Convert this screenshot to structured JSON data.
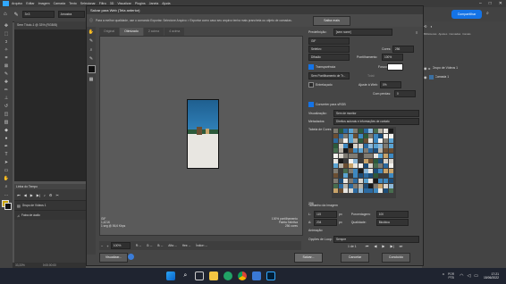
{
  "ps": {
    "menu": [
      "Arquivo",
      "Editar",
      "Imagem",
      "Camada",
      "Texto",
      "Selecionar",
      "Filtro",
      "3D",
      "Visualizar",
      "Plugins",
      "Janela",
      "Ajuda"
    ],
    "doc_tab": "Sem Título-1 @ 33% (RGB/8)",
    "share_label": "Compartilhar",
    "sample_label": "Amostra",
    "timeline_title": "Linha do Tempo",
    "layer_track": "Grupo de Vídeos 1",
    "audio_track": "Faixa de áudio",
    "status_zoom": "33,33%",
    "status_time": "0:00:00:00",
    "right_tabs": [
      "Bibliotecas",
      "Ajustes",
      "Camadas",
      "Canais",
      "Demarcadores",
      "Propriedades"
    ],
    "layers": [
      "Grupo de Vídeos 1",
      "Camada 1"
    ]
  },
  "dialog": {
    "title": "Salvar para Web (Tela anterior)",
    "info_text": "Para a melhor qualidade, use o comando Exportar. Selecione Arquivo > Exportar como caso seu arquivo tenha mais prancheta ou objeto de camadas.",
    "more_label": "Saiba mais",
    "tabs": [
      "Original",
      "Otimizado",
      "2 acima",
      "4 acima"
    ],
    "active_tab": "Otimizado",
    "preview_left_lines": [
      "GIF",
      "1,421K",
      "1 seg @ 56,6 Kbps"
    ],
    "preview_right_lines": [
      "100% pontilhamento",
      "Paleta Seletiva",
      "256 cores"
    ],
    "zoom_value": "100%",
    "zoom_r": "R: --",
    "zoom_g": "G: --",
    "zoom_b": "B: --",
    "zoom_alpha": "Alfa: --",
    "zoom_hex": "Hex: --",
    "zoom_index": "Índice: --",
    "preview_btn": "Visualizar...",
    "save_btn": "Salvar...",
    "cancel_btn": "Cancelar",
    "done_btn": "Concluído",
    "settings": {
      "preset_label": "Predefinição:",
      "preset_value": "[sem nome]",
      "format": "GIF",
      "reduction": "Seletivo",
      "colors_label": "Cores:",
      "colors_value": "256",
      "dither_algo": "Difusão",
      "dither_label": "Pontilhamento:",
      "dither_value": "100%",
      "transparency_label": "Transparência",
      "matte_label": "Fosco:",
      "transparency_dither": "Sem Pontilhamento de Tr...",
      "amount_label": "Total:",
      "interlaced_label": "Entrelaçado",
      "web_snap_label": "Ajuste à Web:",
      "web_snap_value": "0%",
      "lossy_label": "Com perdas:",
      "lossy_value": "0",
      "convert_srgb_label": "Converter para sRGB",
      "preview_label": "Visualização:",
      "preview_value": "Sem de monitor",
      "metadata_label": "Metadados:",
      "metadata_value": "Direitos autorais e informações de contato",
      "color_table_label": "Tabela de Cores",
      "color_count": "256",
      "image_size_label": "Tamanho da Imagem",
      "w_label": "L:",
      "w_value": "115",
      "h_label": "A:",
      "h_value": "204",
      "px": "px",
      "percent_label": "Porcentagem:",
      "percent_value": "100",
      "quality_label": "Qualidade:",
      "quality_value": "Bicúbica",
      "animation_label": "Animação",
      "loop_label": "Opções de Loop:",
      "loop_value": "Sempre",
      "frame_counter": "1 de 1"
    }
  },
  "taskbar": {
    "lang": "POR",
    "lang2": "PTB",
    "time": "17:21",
    "date": "15/06/2022"
  },
  "colors": {
    "accent": "#1473e6",
    "dialog_bg": "#464646",
    "ps_bg": "#535353"
  }
}
